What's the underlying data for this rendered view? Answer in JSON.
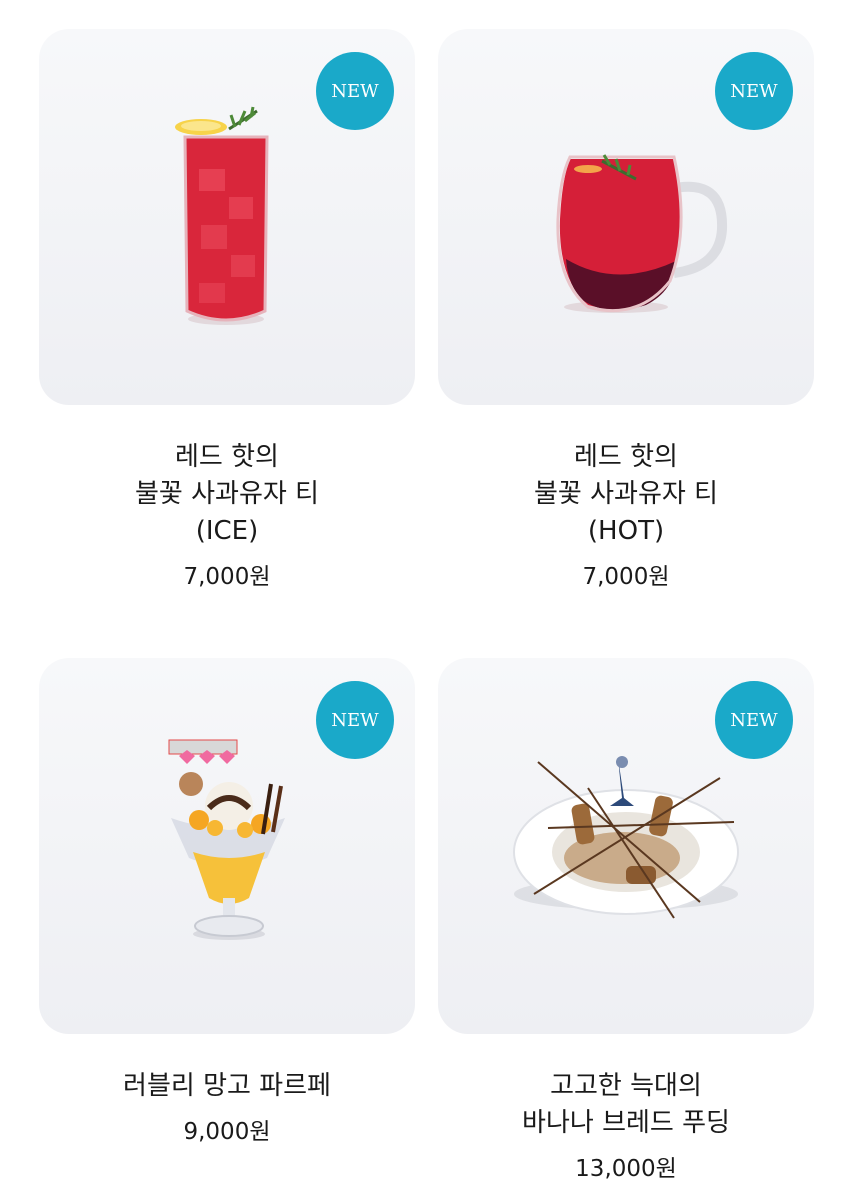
{
  "colors": {
    "badge": "#1aa9c9",
    "card_bg": "#f1f2f5"
  },
  "products": [
    {
      "badge": "NEW",
      "image_icon": "iced-red-tea-glass",
      "name_lines": [
        "레드 핫의",
        "불꽃 사과유자 티",
        "(ICE)"
      ],
      "price": "7,000원"
    },
    {
      "badge": "NEW",
      "image_icon": "hot-red-tea-mug",
      "name_lines": [
        "레드 핫의",
        "불꽃 사과유자 티",
        "(HOT)"
      ],
      "price": "7,000원"
    },
    {
      "badge": "NEW",
      "image_icon": "mango-parfait-glass",
      "name_lines": [
        "러블리 망고 파르페"
      ],
      "price": "9,000원"
    },
    {
      "badge": "NEW",
      "image_icon": "banana-bread-pudding-plate",
      "name_lines": [
        "고고한 늑대의",
        "바나나 브레드 푸딩"
      ],
      "price": "13,000원"
    }
  ]
}
